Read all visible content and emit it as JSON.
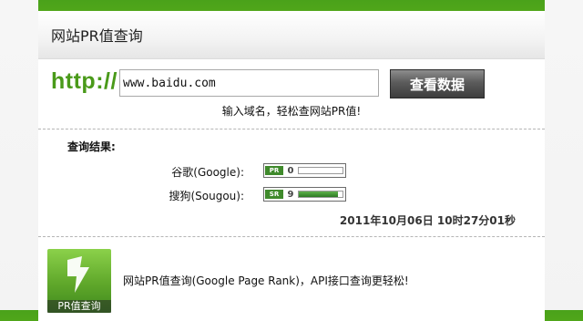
{
  "header": {
    "title": "网站PR值查询"
  },
  "search": {
    "prefix": "http://",
    "input_value": "www.baidu.com",
    "button_label": "查看数据",
    "hint": "输入域名，轻松查网站PR值!"
  },
  "results": {
    "label": "查询结果:",
    "rows": [
      {
        "label": "谷歌(Google):",
        "badge_tag": "PR",
        "value": "0",
        "level": 0.0
      },
      {
        "label": "搜狗(Sougou):",
        "badge_tag": "SR",
        "value": "9",
        "level": 0.9
      }
    ],
    "timestamp": "2011年10月06日  10时27分01秒"
  },
  "footer": {
    "icon_caption": "PR值查询",
    "text": "网站PR值查询(Google Page Rank)，API接口查询更轻松!"
  },
  "colors": {
    "accent_green": "#4a9a1a",
    "bar_green": "#2c7a22",
    "button_dark": "#3d3d3d"
  }
}
